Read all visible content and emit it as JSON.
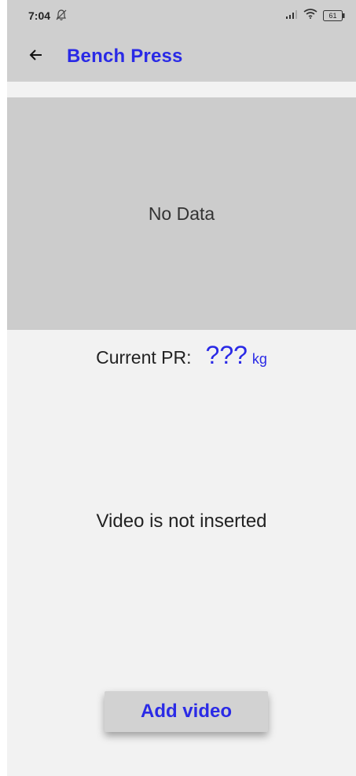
{
  "status_bar": {
    "time": "7:04",
    "battery": "61",
    "icons": [
      "notifications-off-icon",
      "signal-icon",
      "wifi-icon",
      "battery-icon"
    ]
  },
  "app_bar": {
    "back_icon": "arrow-left-icon",
    "title": "Bench Press"
  },
  "chart": {
    "empty_text": "No Data"
  },
  "personal_record": {
    "label": "Current PR:",
    "value": "???",
    "unit": "kg"
  },
  "video": {
    "status_text": "Video is not inserted",
    "add_button_label": "Add video"
  },
  "colors": {
    "accent": "#2a2ae6",
    "app_bar_bg": "#cfcfcf",
    "page_bg": "#f2f2f2",
    "chart_bg": "#cccccc"
  }
}
